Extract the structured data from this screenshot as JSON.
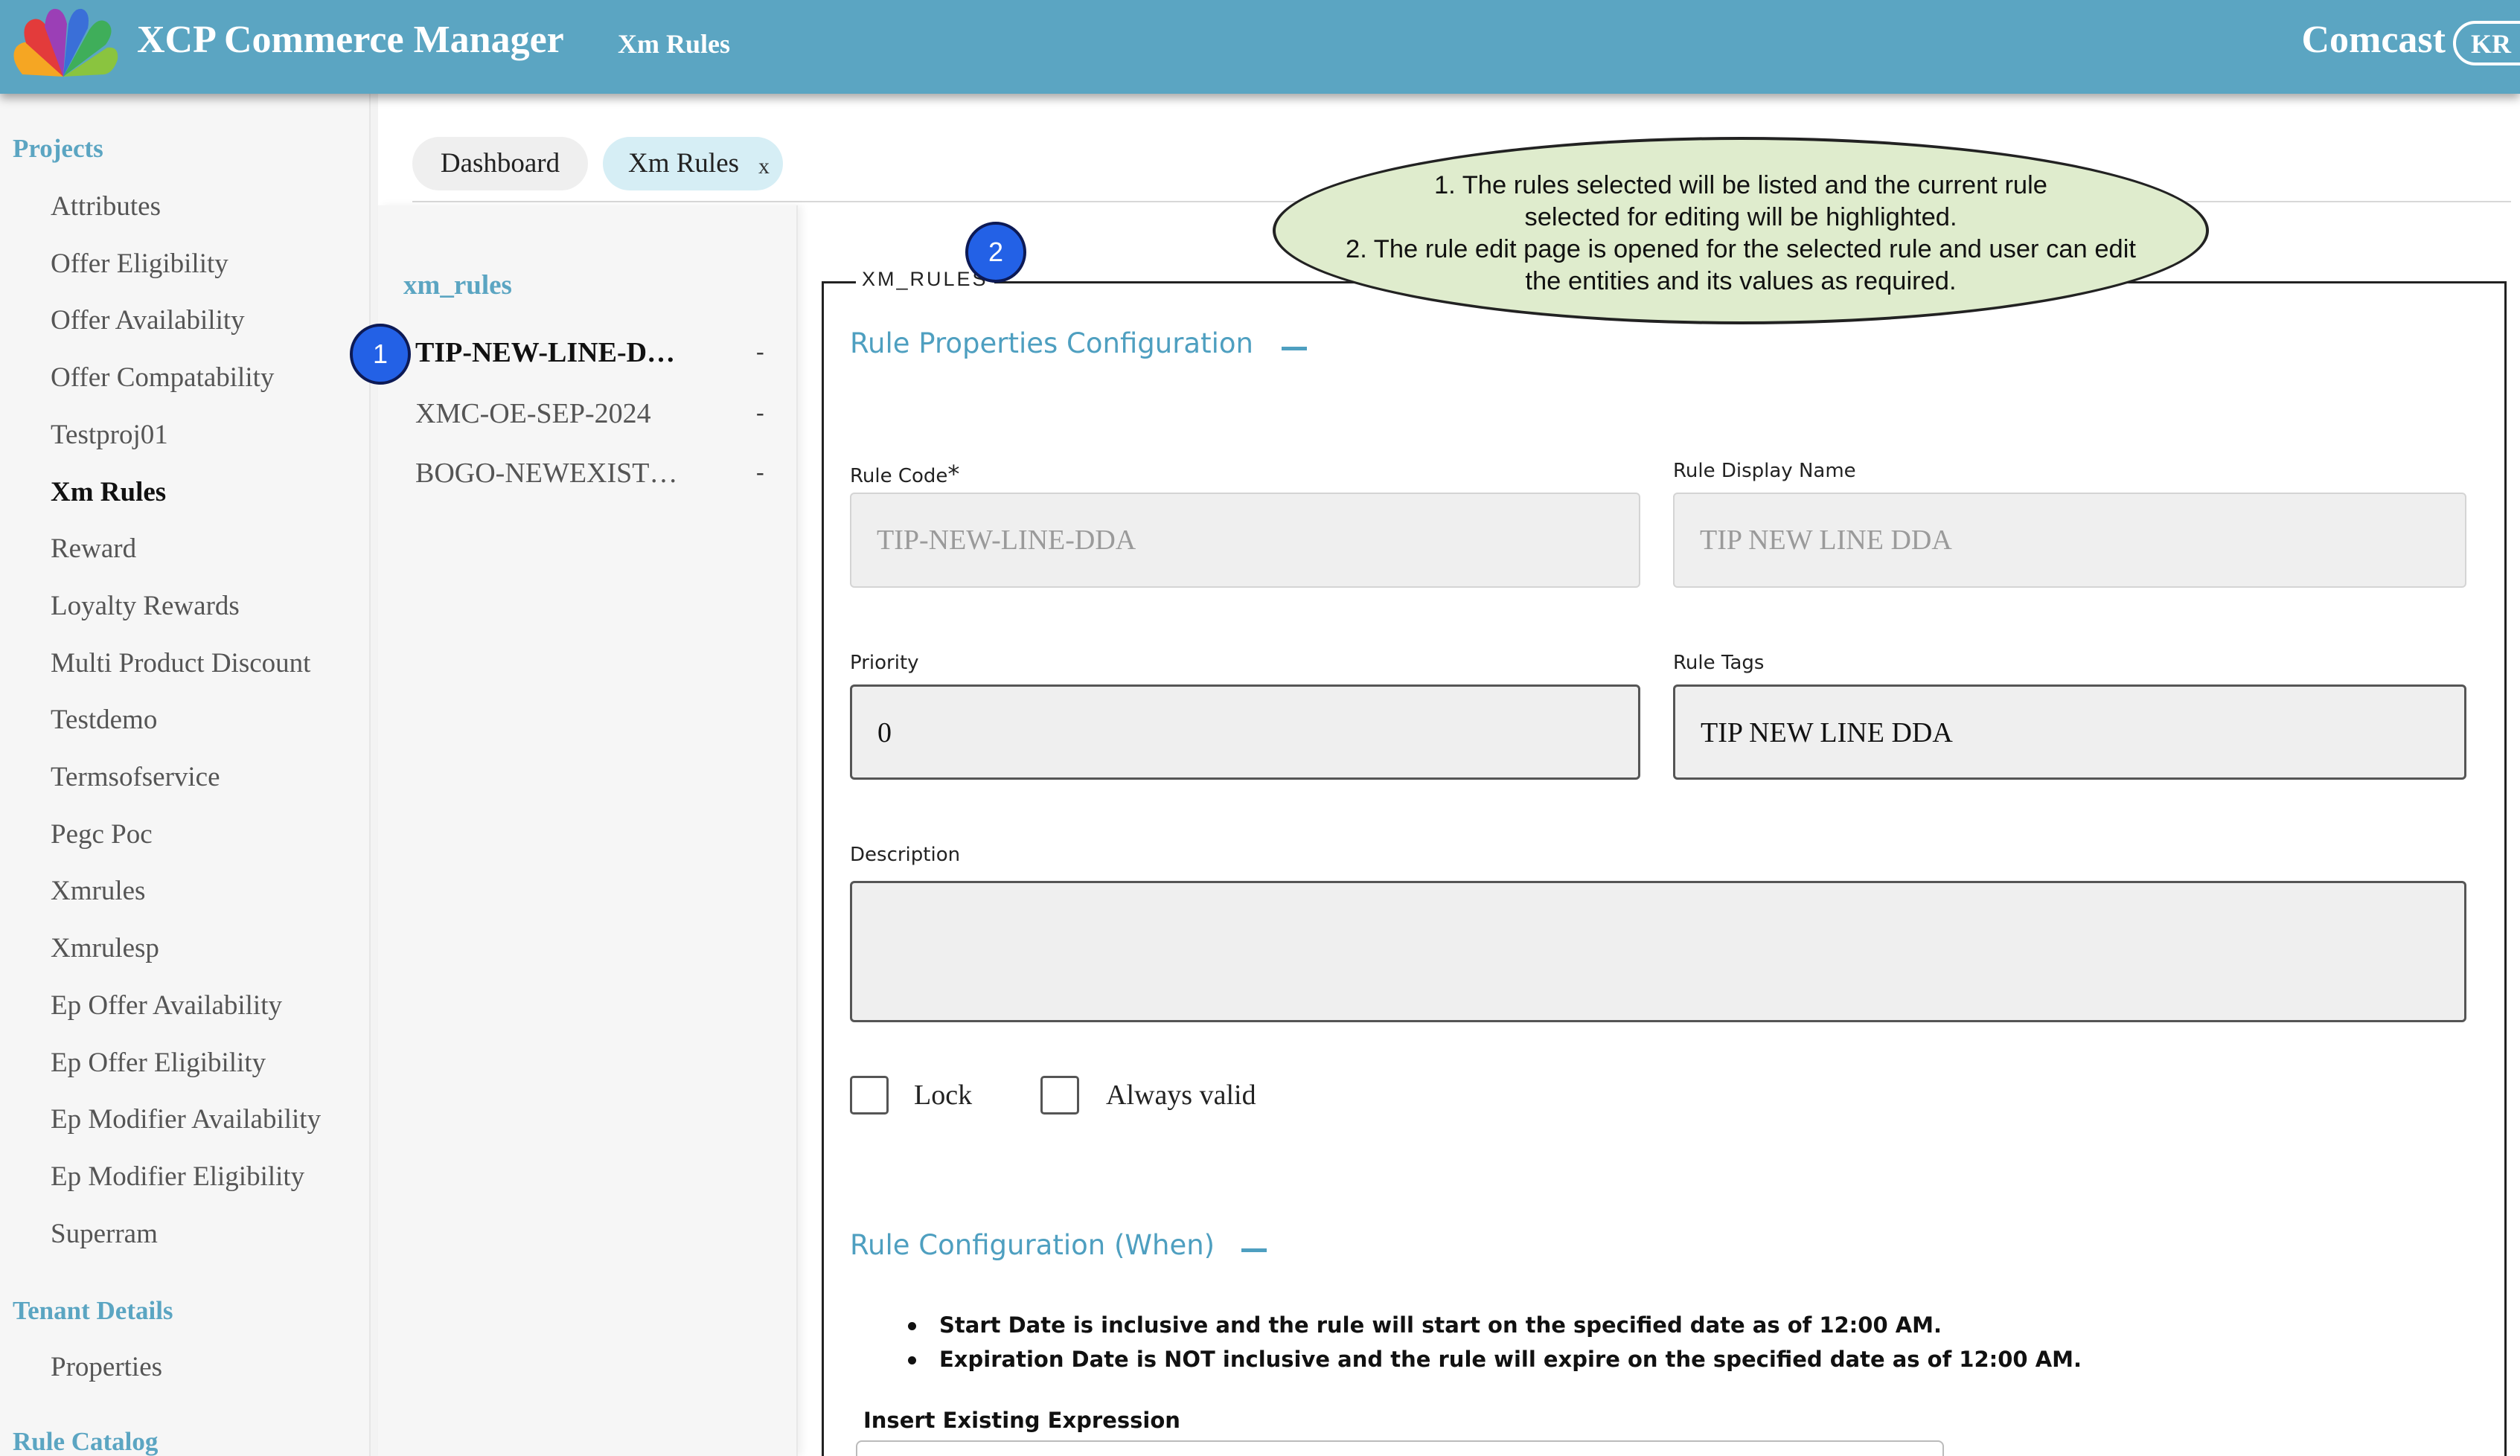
{
  "header": {
    "app_title": "XCP Commerce Manager",
    "nav_label": "Xm Rules",
    "brand": "Comcast",
    "avatar_initials": "KR",
    "background_color": "#5ba5c2"
  },
  "sidebar": {
    "projects_title": "Projects",
    "project_items": [
      "Attributes",
      "Offer Eligibility",
      "Offer Availability",
      "Offer Compatability",
      "Testproj01",
      "Xm Rules",
      "Reward",
      "Loyalty Rewards",
      "Multi Product Discount",
      "Testdemo",
      "Termsofservice",
      "Pegc Poc",
      "Xmrules",
      "Xmrulesp",
      "Ep Offer Availability",
      "Ep Offer Eligibility",
      "Ep Modifier Availability",
      "Ep Modifier Eligibility",
      "Superram"
    ],
    "active_item": "Xm Rules",
    "tenant_title": "Tenant Details",
    "tenant_items": [
      "Properties"
    ],
    "catalog_title": "Rule Catalog"
  },
  "tabs": {
    "dashboard": "Dashboard",
    "xm_rules": "Xm Rules",
    "close": "x"
  },
  "rule_list": {
    "title": "xm_rules",
    "items": [
      {
        "label": "TIP-NEW-LINE-D…",
        "action": "-"
      },
      {
        "label": "XMC-OE-SEP-2024",
        "action": "-"
      },
      {
        "label": "BOGO-NEWEXIST…",
        "action": "-"
      }
    ]
  },
  "markers": {
    "one": "1",
    "two": "2"
  },
  "callout": {
    "line1": "1. The rules selected will be listed and the current rule",
    "line2": "selected for editing will be highlighted.",
    "line3": "2. The rule edit page is opened for the selected rule and user can edit",
    "line4": "the entities and its values as required."
  },
  "form": {
    "legend": "XM_RULES",
    "properties_title": "Rule Properties Configuration",
    "rule_code_label": "Rule Code",
    "rule_code_required": "*",
    "rule_code_value": "TIP-NEW-LINE-DDA",
    "display_name_label": "Rule Display Name",
    "display_name_value": "TIP NEW LINE DDA",
    "priority_label": "Priority",
    "priority_value": "0",
    "tags_label": "Rule Tags",
    "tags_value": "TIP NEW LINE DDA",
    "description_label": "Description",
    "description_value": "",
    "lock_label": "Lock",
    "always_valid_label": "Always valid",
    "when_title": "Rule Configuration (When)",
    "notes": [
      "Start Date is inclusive and the rule will start on the specified date as of 12:00 AM.",
      "Expiration Date is NOT inclusive and the rule will expire on the specified date as of 12:00 AM."
    ],
    "insert_expression_label": "Insert Existing Expression"
  }
}
